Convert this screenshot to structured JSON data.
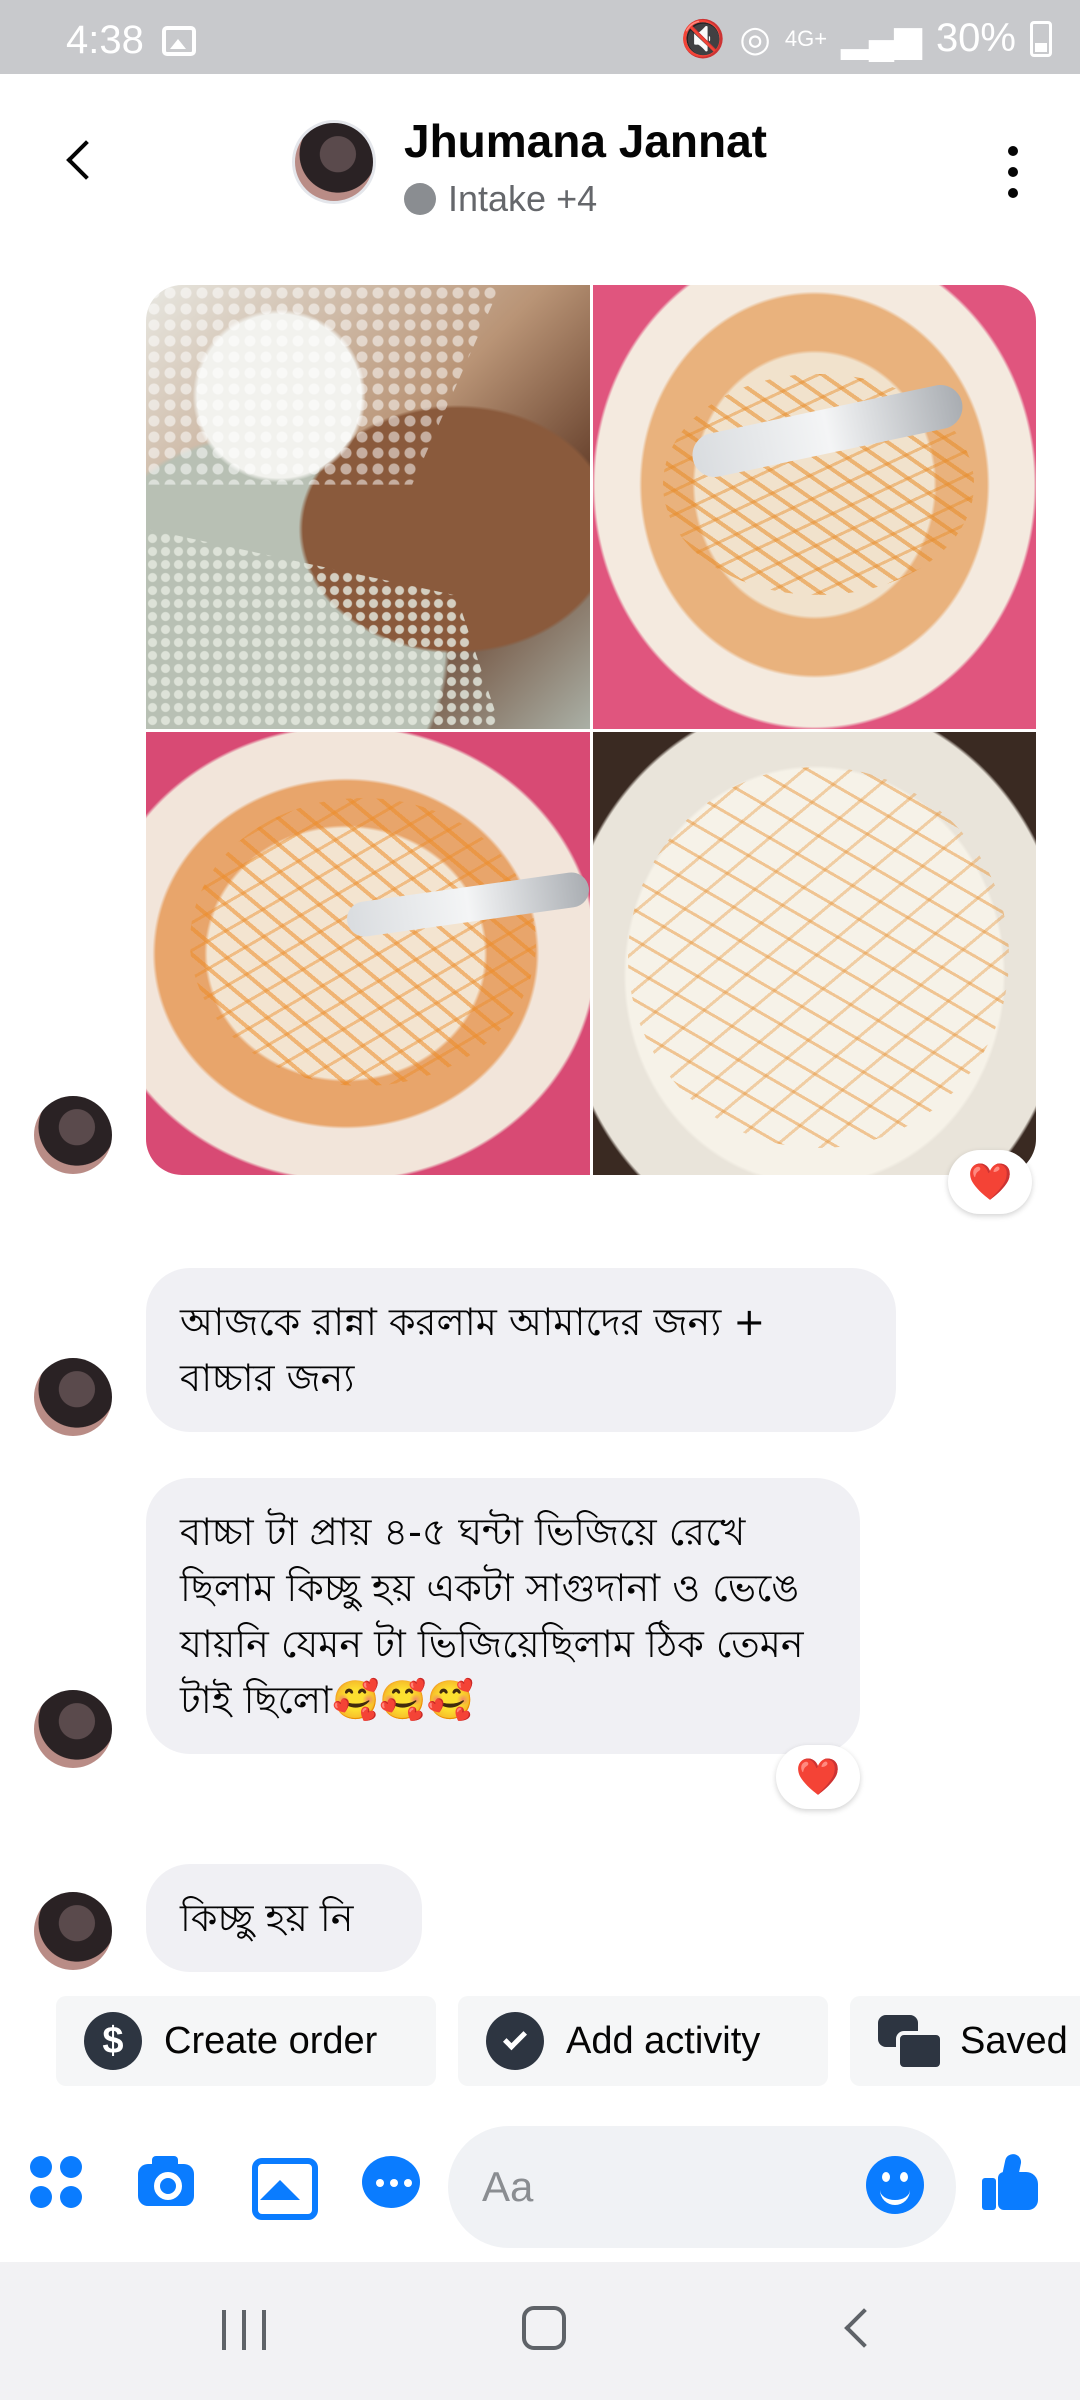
{
  "status_bar": {
    "time": "4:38",
    "icons": [
      "gallery-icon",
      "mute-icon",
      "hotspot-icon",
      "4g-plus-icon",
      "signal-icon"
    ],
    "network_label": "4G+",
    "battery_percent": "30%"
  },
  "header": {
    "contact_name": "Jhumana Jannat",
    "status_text": "Intake +4"
  },
  "messages": {
    "photo_reaction": "❤️",
    "text_1": "আজকে রান্না করলাম আমাদের জন্য + বাচ্চার জন্য",
    "text_2": "বাচ্চা টা প্রায় ৪-৫ ঘন্টা ভিজিয়ে রেখে ছিলাম কিচ্ছু হয় একটা সাগুদানা ও ভেঙে যায়নি যেমন টা ভিজিয়েছিলাম ঠিক তেমন টাই ছিলো🥰🥰🥰",
    "text_2_reaction": "❤️",
    "text_3": "কিচ্ছু হয় নি"
  },
  "quick_actions": {
    "create_order": "Create order",
    "create_order_icon": "$",
    "add_activity": "Add activity",
    "saved": "Saved"
  },
  "composer": {
    "placeholder": "Aa"
  },
  "colors": {
    "accent": "#0a7cff",
    "bubble": "#f0f0f4",
    "reaction": "#f0284a"
  }
}
